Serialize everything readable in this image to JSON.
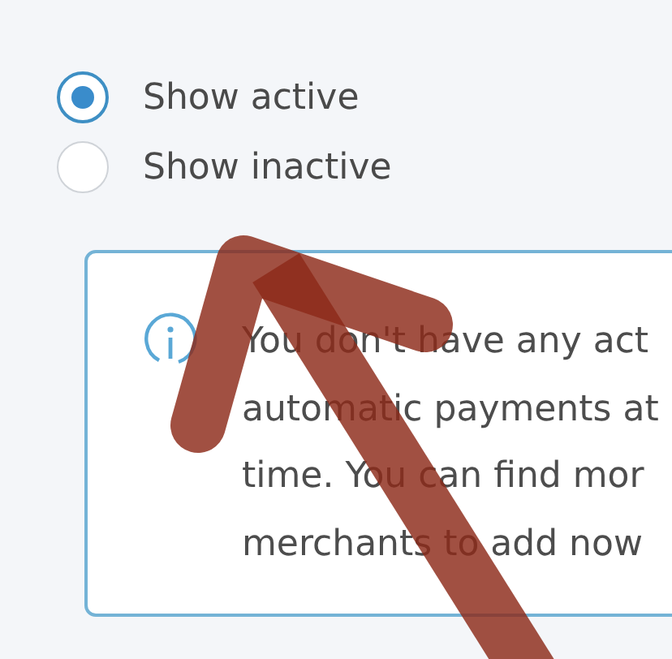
{
  "filter_options": [
    {
      "label": "Show active",
      "selected": true
    },
    {
      "label": "Show inactive",
      "selected": false
    }
  ],
  "info_notice": {
    "lines": [
      "You don't have any act",
      "automatic payments at",
      "time. You can find mor",
      "merchants to add now"
    ]
  }
}
